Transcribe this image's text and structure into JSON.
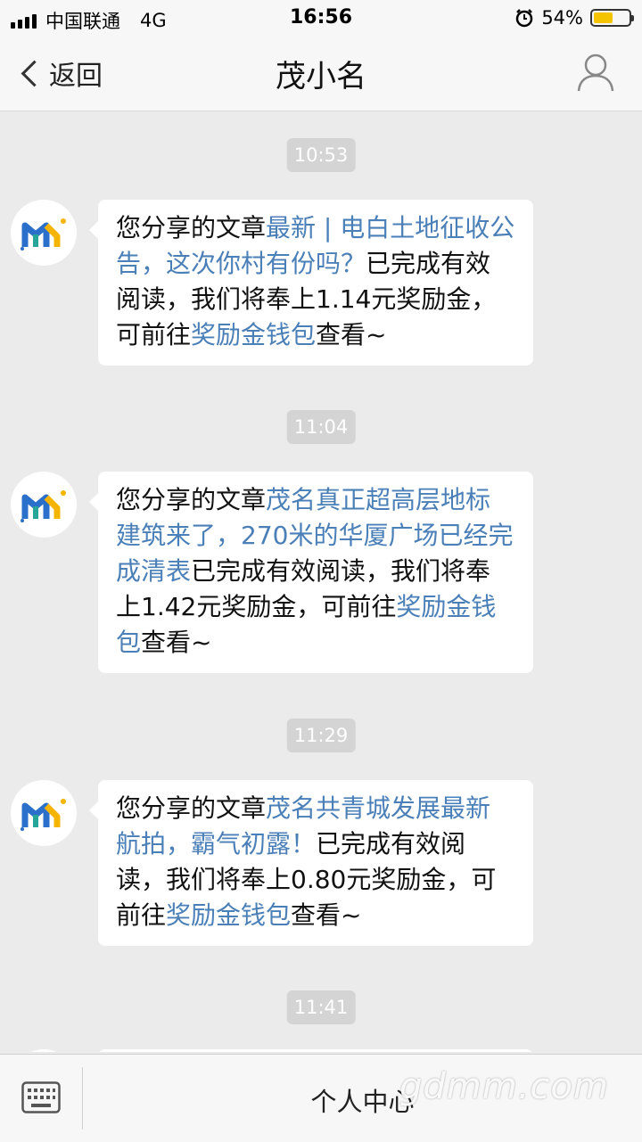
{
  "status_bar": {
    "carrier": "中国联通",
    "network": "4G",
    "time": "16:56",
    "battery_percent": "54%",
    "battery_level": 0.54,
    "battery_color": "#f5c400"
  },
  "nav": {
    "back_label": "返回",
    "title": "茂小名",
    "profile_icon": "person-icon"
  },
  "messages": [
    {
      "time": "10:53",
      "parts": [
        {
          "text": "您分享的文章",
          "link": false
        },
        {
          "text": "最新 | 电白土地征收公告，这次你村有份吗？",
          "link": true
        },
        {
          "text": "已完成有效阅读，我们将奉上1.14元奖励金，可前往",
          "link": false
        },
        {
          "text": "奖励金钱包",
          "link": true
        },
        {
          "text": "查看~",
          "link": false
        }
      ]
    },
    {
      "time": "11:04",
      "parts": [
        {
          "text": "您分享的文章",
          "link": false
        },
        {
          "text": "茂名真正超高层地标建筑来了，270米的华厦广场已经完成清表",
          "link": true
        },
        {
          "text": "已完成有效阅读，我们将奉上1.42元奖励金，可前往",
          "link": false
        },
        {
          "text": "奖励金钱包",
          "link": true
        },
        {
          "text": "查看~",
          "link": false
        }
      ]
    },
    {
      "time": "11:29",
      "parts": [
        {
          "text": "您分享的文章",
          "link": false
        },
        {
          "text": "茂名共青城发展最新航拍，霸气初露！",
          "link": true
        },
        {
          "text": "已完成有效阅读，我们将奉上0.80元奖励金，可前往",
          "link": false
        },
        {
          "text": "奖励金钱包",
          "link": true
        },
        {
          "text": "查看~",
          "link": false
        }
      ]
    },
    {
      "time": "11:41",
      "parts": []
    }
  ],
  "bottom_bar": {
    "keyboard_icon": "keyboard-icon",
    "menu_label": "个人中心"
  },
  "watermark": "gdmm.com",
  "colors": {
    "link": "#4a7fb7",
    "background": "#ebebeb",
    "bubble": "#ffffff",
    "time_badge": "#d4d4d4"
  }
}
